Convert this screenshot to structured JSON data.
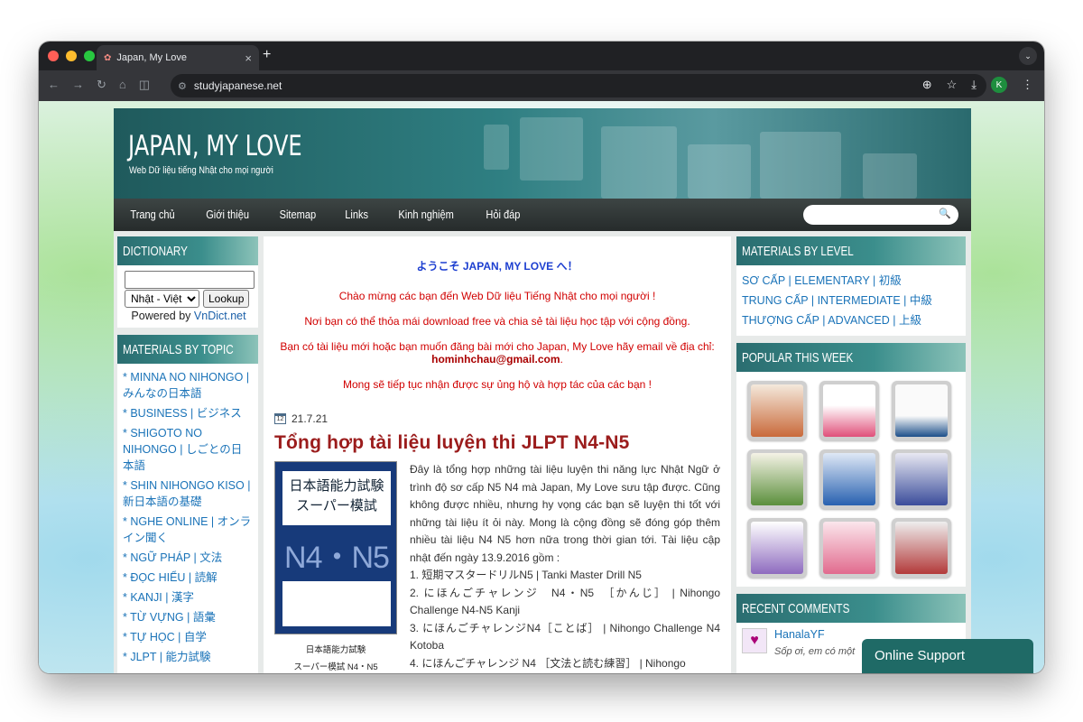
{
  "browser": {
    "tab_title": "Japan, My Love",
    "tab_close": "×",
    "new_tab": "+",
    "url": "studyjapanese.net",
    "profile_initial": "K"
  },
  "site": {
    "title": "JAPAN, MY LOVE",
    "description": "Web Dữ liệu tiếng Nhật cho mọi người",
    "menu": [
      "Trang chủ",
      "Giới thiệu",
      "Sitemap",
      "Links",
      "Kinh nghiệm",
      "Hỏi đáp"
    ]
  },
  "dictionary": {
    "title": "DICTIONARY",
    "input_value": "",
    "select_value": "Nhật - Việt",
    "button": "Lookup",
    "powered_prefix": "Powered by",
    "powered_link": "VnDict.net"
  },
  "topics": {
    "title": "MATERIALS BY TOPIC",
    "items": [
      "* MINNA NO NIHONGO | みんなの日本語",
      "* BUSINESS | ビジネス",
      "* SHIGOTO NO NIHONGO | しごとの日本語",
      "* SHIN NIHONGO KISO | 新日本語の基礎",
      "* NGHE ONLINE | オンライン聞く",
      "* NGỮ PHÁP | 文法",
      "* ĐỌC HIỂU | 読解",
      "* KANJI | 漢字",
      "* TỪ VỰNG | 語彙",
      "* TỰ HỌC | 自学",
      "* JLPT | 能力試験"
    ]
  },
  "welcome": {
    "line1": "ようこそ JAPAN, MY LOVE へ！",
    "line2": "Chào mừng các bạn đến Web Dữ liệu Tiếng Nhật cho mọi người !",
    "line3": "Nơi bạn có thể thỏa mái download free và chia sẻ tài liệu học tập với cộng đồng.",
    "line4": "Bạn có tài liệu mới hoặc bạn muốn đăng bài mới cho Japan, My Love hãy email về địa chỉ:",
    "email": "hominhchau@gmail.com",
    "line5": "Mong sẽ tiếp tục nhận được sự ủng hộ và hợp tác của các bạn !"
  },
  "post": {
    "date": "21.7.21",
    "title": "Tổng hợp tài liệu luyện thi JLPT N4-N5",
    "cover_line1": "日本語能力試験",
    "cover_line2": "スーパー模試",
    "cover_level": "N4・N5",
    "caption_line1": "日本語能力試験",
    "caption_line2": "スーパー模試 N4・N5",
    "body": "Đây là tổng hợp những tài liệu luyện thi năng lực Nhật Ngữ ở trình độ sơ cấp N5 N4 mà Japan, My Love sưu tập được. Cũng không được nhiều, nhưng hy vọng các bạn sẽ luyện thi tốt với những tài liệu ít ỏi này. Mong là cộng đồng sẽ đóng góp thêm nhiều tài liệu N4 N5 hơn nữa trong thời gian tới. Tài liệu cập nhật đến ngày 13.9.2016 gồm :",
    "list": [
      "1. 短期マスタードリルN5 | Tanki Master Drill N5",
      "2. にほんごチャレンジ　N4・N5　［かんじ］ | Nihongo Challenge N4-N5 Kanji",
      "3. にほんごチャレンジN4［ことば］ | Nihongo Challenge N4 Kotoba",
      "4. にほんごチャレンジ N4 ［文法と読む練習］ | Nihongo"
    ]
  },
  "levels": {
    "title": "MATERIALS BY LEVEL",
    "items": [
      "SƠ CẤP | ELEMENTARY | 初級",
      "TRUNG CẤP | INTERMEDIATE | 中級",
      "THƯỢNG CẤP | ADVANCED | 上級"
    ]
  },
  "popular": {
    "title": "POPULAR THIS WEEK",
    "thumb_colors": [
      "#e8d6c8",
      "#f3b6c7",
      "#f0f0f0",
      "#e6e8f0",
      "#c9d7ee",
      "#d8dcea",
      "#dad2ec",
      "#f6d6de",
      "#e7e7e7"
    ]
  },
  "comments": {
    "title": "RECENT COMMENTS",
    "author": "HanalaYF",
    "text": "Sốp ơi, em có một"
  },
  "support": {
    "label": "Online Support"
  },
  "colors": {
    "header": "#2f7f82",
    "menubar": "#2f3535",
    "link": "#1a73b8",
    "welcome_blue": "#1d3fd0",
    "welcome_red": "#d10000",
    "post_title": "#9b1c1c"
  }
}
